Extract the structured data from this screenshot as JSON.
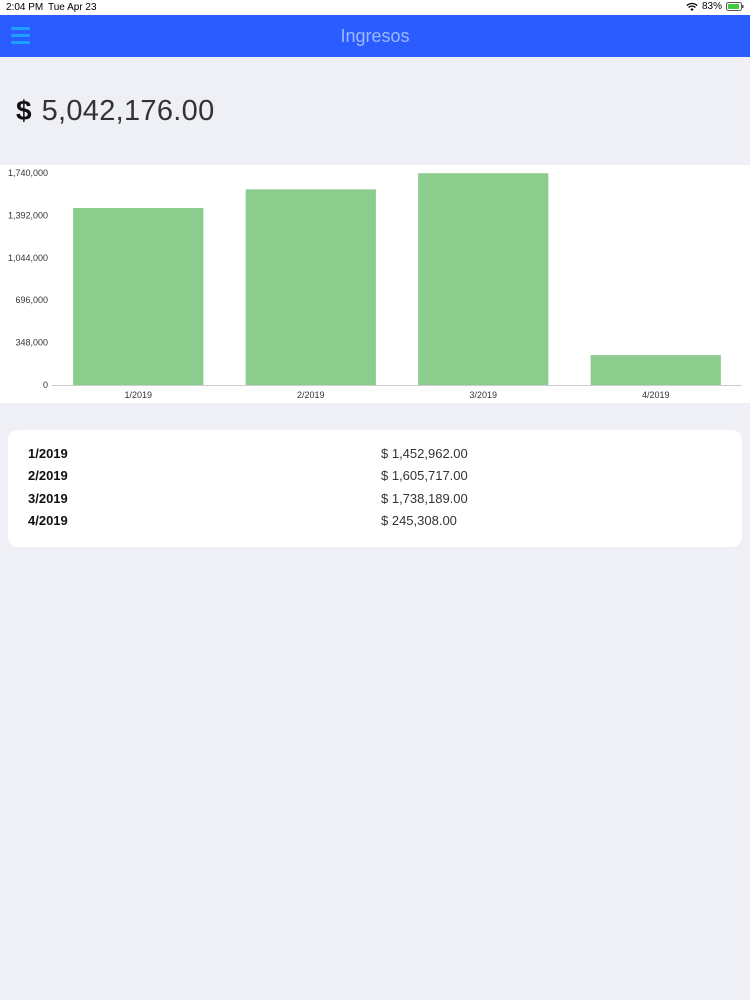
{
  "status_bar": {
    "time": "2:04 PM",
    "date": "Tue Apr 23",
    "battery": "83%"
  },
  "nav": {
    "title": "Ingresos",
    "menu_icon": "hamburger-menu-icon"
  },
  "total": {
    "currency": "$",
    "amount": "5,042,176.00"
  },
  "colors": {
    "nav_bg": "#2a5cff",
    "bar_fill": "#8ccc8c",
    "page_bg": "#eef0f5"
  },
  "chart_data": {
    "type": "bar",
    "categories": [
      "1/2019",
      "2/2019",
      "3/2019",
      "4/2019"
    ],
    "values": [
      1452962,
      1605717,
      1738189,
      245308
    ],
    "yticks": [
      "0",
      "348,000",
      "696,000",
      "1,044,000",
      "1,392,000",
      "1,740,000"
    ],
    "ytick_values": [
      0,
      348000,
      696000,
      1044000,
      1392000,
      1740000
    ],
    "ylim": [
      0,
      1740000
    ],
    "grid": false,
    "legend": "none"
  },
  "table": {
    "rows": [
      {
        "period": "1/2019",
        "amount": "$ 1,452,962.00"
      },
      {
        "period": "2/2019",
        "amount": "$ 1,605,717.00"
      },
      {
        "period": "3/2019",
        "amount": "$ 1,738,189.00"
      },
      {
        "period": "4/2019",
        "amount": "$ 245,308.00"
      }
    ]
  }
}
